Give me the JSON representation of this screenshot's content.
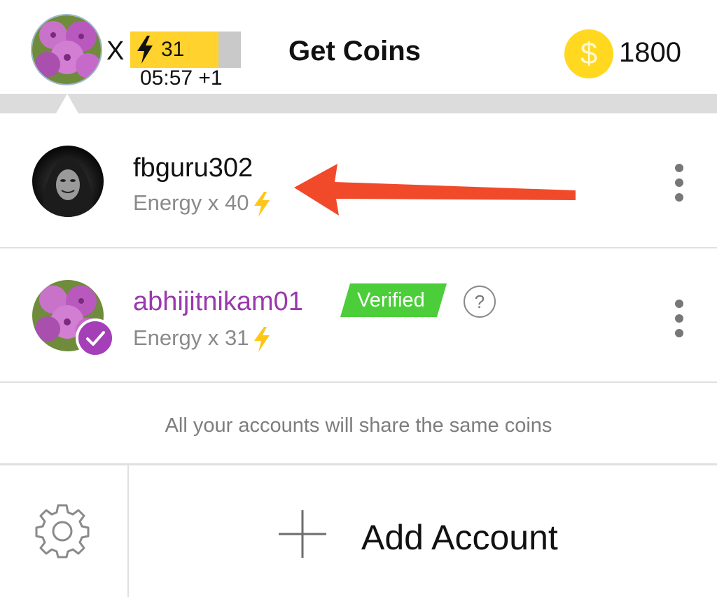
{
  "header": {
    "multiplier": "X",
    "energy_count": "31",
    "energy_fraction": 0.8,
    "timer": "05:57 +1",
    "title": "Get Coins",
    "coin_symbol": "$",
    "coins": "1800"
  },
  "accounts": [
    {
      "username": "fbguru302",
      "energy": "Energy x 40",
      "username_color": "#111111"
    },
    {
      "username": "abhijitnikam01",
      "energy": "Energy x 31",
      "username_color": "#9a39ad",
      "badge": "Verified",
      "help": "?"
    }
  ],
  "note": "All your accounts will share the same coins",
  "footer": {
    "add_label": "Add Account"
  },
  "colors": {
    "energy_yellow": "#ffd22e",
    "coin_yellow": "#ffd81f",
    "verified_green": "#4ccd3a",
    "accent_purple": "#a43fb8",
    "annotation_red": "#f04a2a"
  },
  "icons": [
    "lightning-icon",
    "coin-icon",
    "more-vertical-icon",
    "help-icon",
    "check-badge-icon",
    "settings-gear-icon",
    "plus-icon",
    "arrow-annotation"
  ]
}
